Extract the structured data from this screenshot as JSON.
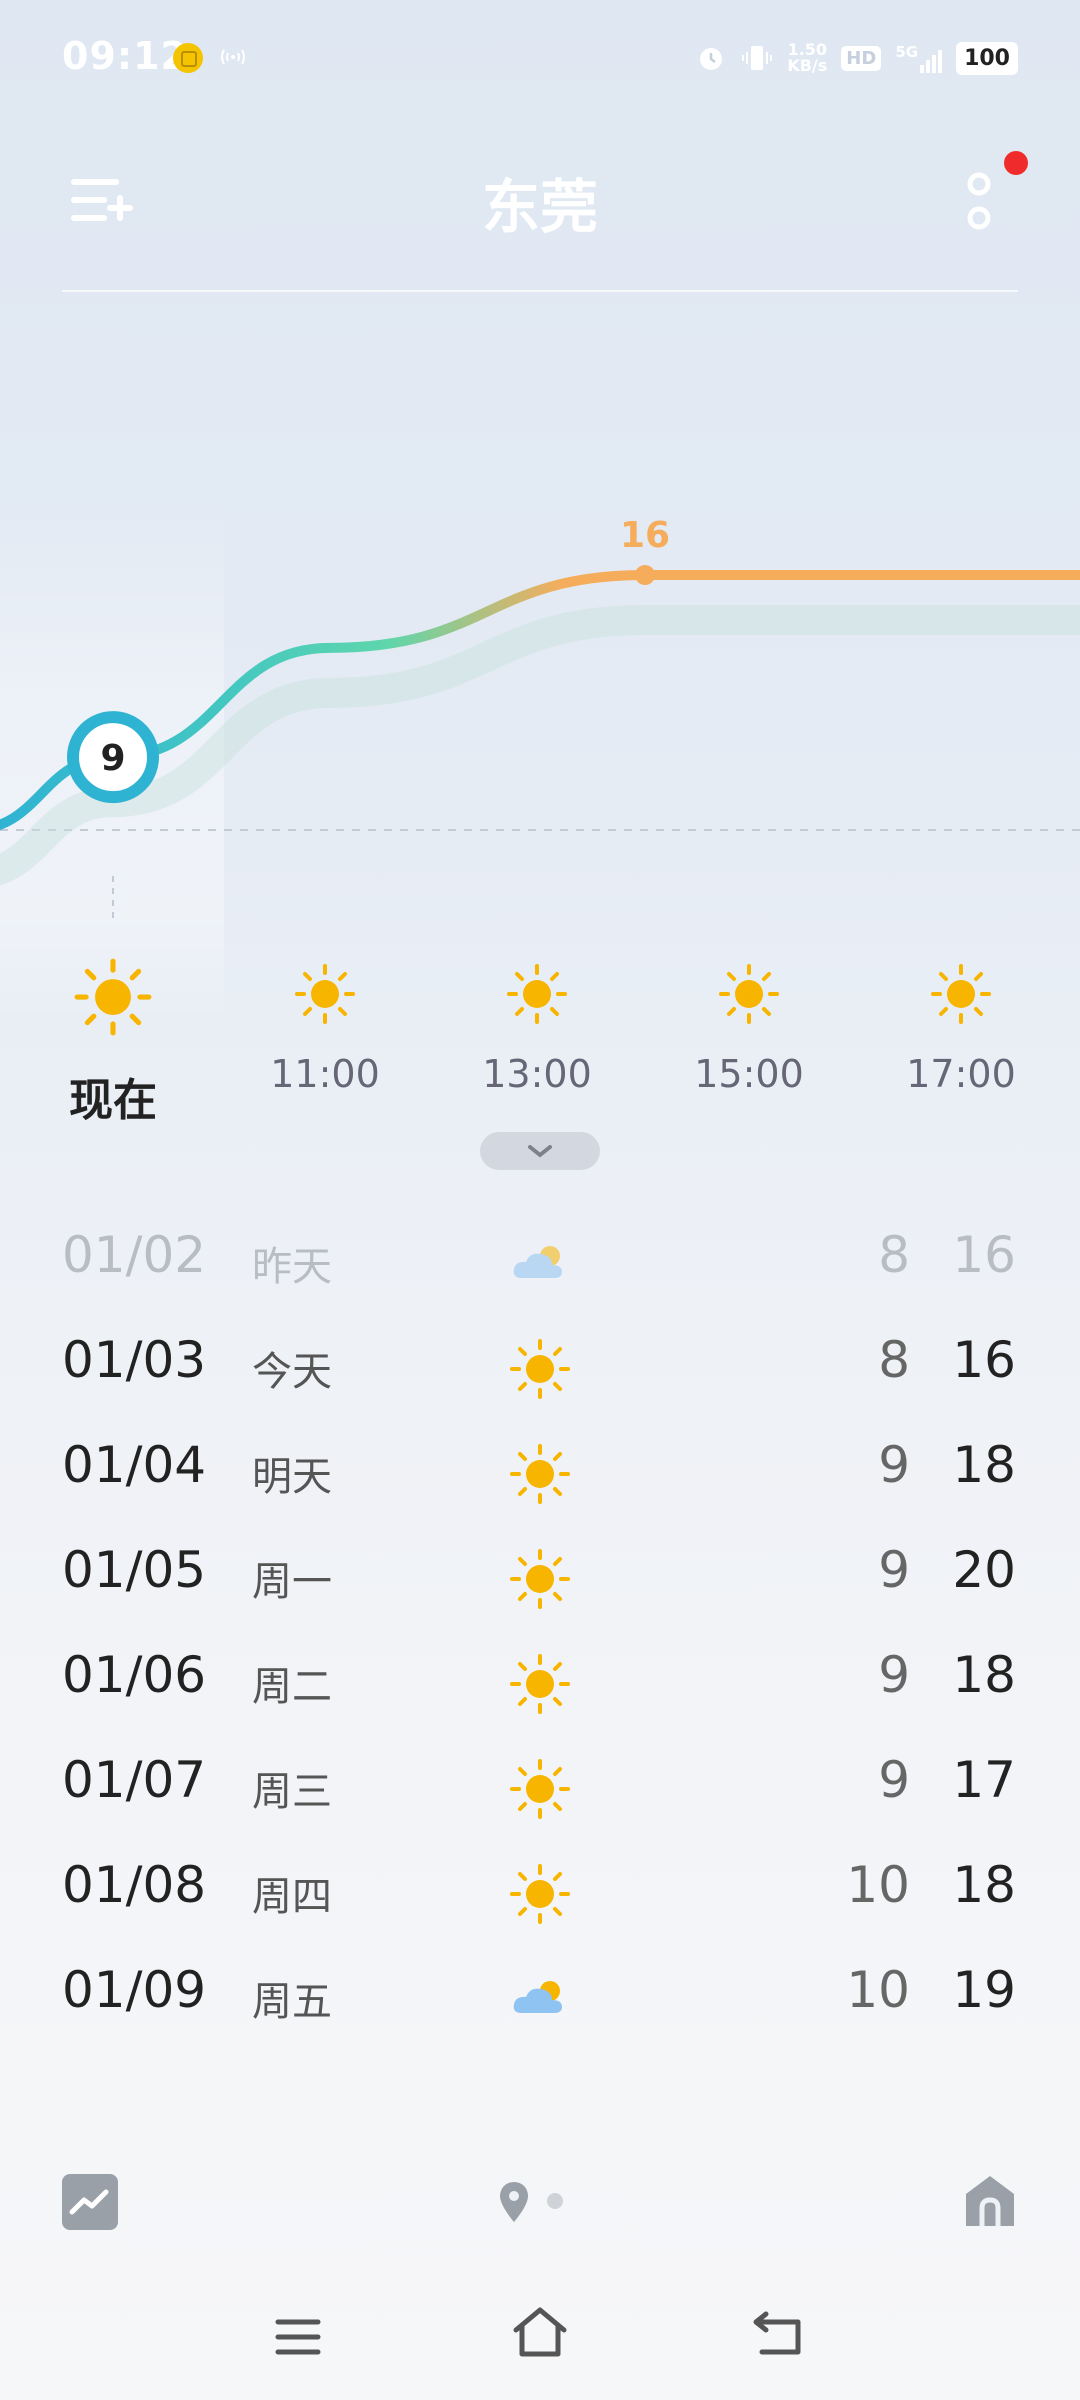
{
  "status_bar": {
    "time": "09:12",
    "net_speed_value": "1.50",
    "net_speed_unit": "KB/s",
    "hd_label": "HD",
    "signal_label": "5G",
    "battery": "100",
    "icons": [
      "coin-icon",
      "nfc-icon",
      "alarm-icon",
      "vibrate-icon",
      "hd-icon",
      "signal-icon",
      "battery-icon"
    ]
  },
  "header": {
    "city": "东莞",
    "menu_icon": "add-city-menu-icon",
    "more_icon": "more-dots-icon",
    "notification_color": "#f02b2b"
  },
  "hourly": {
    "now_temp": "9",
    "peak_temp": "16",
    "hours": [
      {
        "label": "现在",
        "icon": "sun-icon"
      },
      {
        "label": "11:00",
        "icon": "sun-icon"
      },
      {
        "label": "13:00",
        "icon": "sun-icon"
      },
      {
        "label": "15:00",
        "icon": "sun-icon"
      },
      {
        "label": "17:00",
        "icon": "sun-icon"
      }
    ]
  },
  "chart_data": {
    "type": "line",
    "series": [
      {
        "values": [
          9,
          11,
          14,
          16,
          16,
          16
        ]
      }
    ],
    "annotations": [
      "9",
      "16"
    ],
    "colors": {
      "cold": "#2fb3d3",
      "mid": "#5fd6ab",
      "warm": "#f5ad5c"
    }
  },
  "forecast": [
    {
      "date": "01/02",
      "day": "昨天",
      "icon": "partly-cloudy-icon",
      "low": "8",
      "high": "16",
      "past": true
    },
    {
      "date": "01/03",
      "day": "今天",
      "icon": "sun-icon",
      "low": "8",
      "high": "16",
      "past": false
    },
    {
      "date": "01/04",
      "day": "明天",
      "icon": "sun-icon",
      "low": "9",
      "high": "18",
      "past": false
    },
    {
      "date": "01/05",
      "day": "周一",
      "icon": "sun-icon",
      "low": "9",
      "high": "20",
      "past": false
    },
    {
      "date": "01/06",
      "day": "周二",
      "icon": "sun-icon",
      "low": "9",
      "high": "18",
      "past": false
    },
    {
      "date": "01/07",
      "day": "周三",
      "icon": "sun-icon",
      "low": "9",
      "high": "17",
      "past": false
    },
    {
      "date": "01/08",
      "day": "周四",
      "icon": "sun-icon",
      "low": "10",
      "high": "18",
      "past": false
    },
    {
      "date": "01/09",
      "day": "周五",
      "icon": "partly-cloudy-icon",
      "low": "10",
      "high": "19",
      "past": false
    }
  ],
  "bottom_bar": {
    "left_icon": "trend-chart-icon",
    "center_icon": "location-pin-icon",
    "right_icon": "home-icon"
  },
  "nav_bar": {
    "icons": [
      "nav-menu-icon",
      "nav-home-icon",
      "nav-back-icon"
    ]
  },
  "colors": {
    "sun": "#f7b500",
    "cloud": "#8fc3f2"
  }
}
